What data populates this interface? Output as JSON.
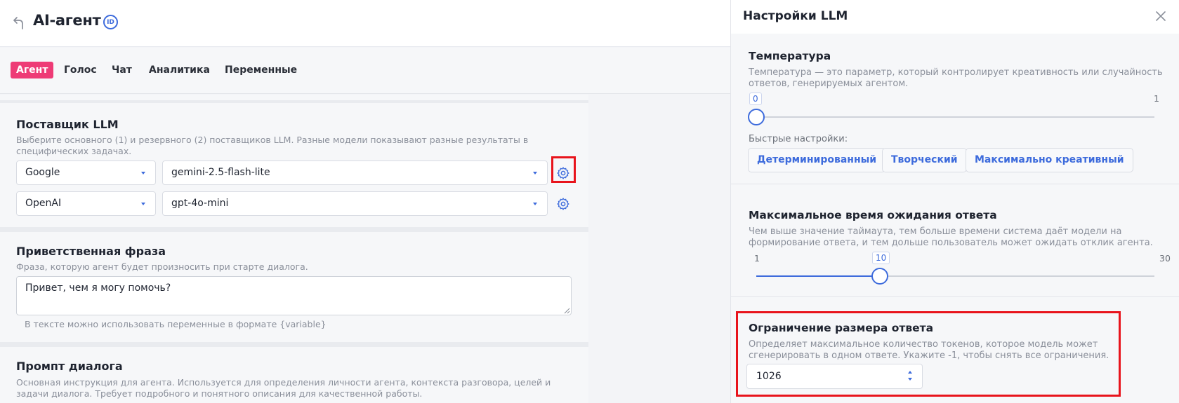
{
  "header": {
    "title": "AI-агент",
    "id_badge": "ID"
  },
  "tabs": [
    {
      "label": "Агент",
      "active": true
    },
    {
      "label": "Голос",
      "active": false
    },
    {
      "label": "Чат",
      "active": false
    },
    {
      "label": "Аналитика",
      "active": false
    },
    {
      "label": "Переменные",
      "active": false
    }
  ],
  "llm_provider": {
    "title": "Поставщик LLM",
    "description": "Выберите основного (1) и резервного (2) поставщиков LLM. Разные модели показывают разные результаты в специфических задачах.",
    "primary": {
      "provider": "Google",
      "model": "gemini-2.5-flash-lite"
    },
    "fallback": {
      "provider": "OpenAI",
      "model": "gpt-4o-mini"
    }
  },
  "greeting": {
    "title": "Приветственная фраза",
    "description": "Фраза, которую агент будет произносить при старте диалога.",
    "value": "Привет, чем я могу помочь?",
    "hint": "В тексте можно использовать переменные в формате {variable}"
  },
  "dialog_prompt": {
    "title": "Промпт диалога",
    "description": "Основная инструкция для агента. Используется для определения личности агента, контекста разговора, целей и задачи диалога. Требует подробного и понятного описания для качественной работы."
  },
  "drawer": {
    "title": "Настройки LLM",
    "temperature": {
      "title": "Температура",
      "description": "Температура — это параметр, который контролирует креативность или случайность ответов, генерируемых агентом.",
      "value": "0",
      "min": "0",
      "max": "1",
      "value_fraction": 0,
      "quick_label": "Быстрые настройки:",
      "presets": [
        "Детерминированный",
        "Творческий",
        "Максимально креативный"
      ]
    },
    "timeout": {
      "title": "Максимальное время ожидания ответа",
      "description": "Чем выше значение таймаута, тем больше времени система даёт модели на формирование ответа, и тем дольше пользователь может ожидать отклик агента.",
      "min": "1",
      "max": "30",
      "value": "10",
      "value_number": 10
    },
    "response_limit": {
      "title": "Ограничение размера ответа",
      "description": "Определяет максимальное количество токенов, которое модель может сгенерировать в одном ответе. Укажите -1, чтобы снять все ограничения.",
      "value": "1026"
    }
  },
  "colors": {
    "accent": "#3d6bdc",
    "active_tab": "#ee3b76",
    "highlight": "#e8141c"
  }
}
